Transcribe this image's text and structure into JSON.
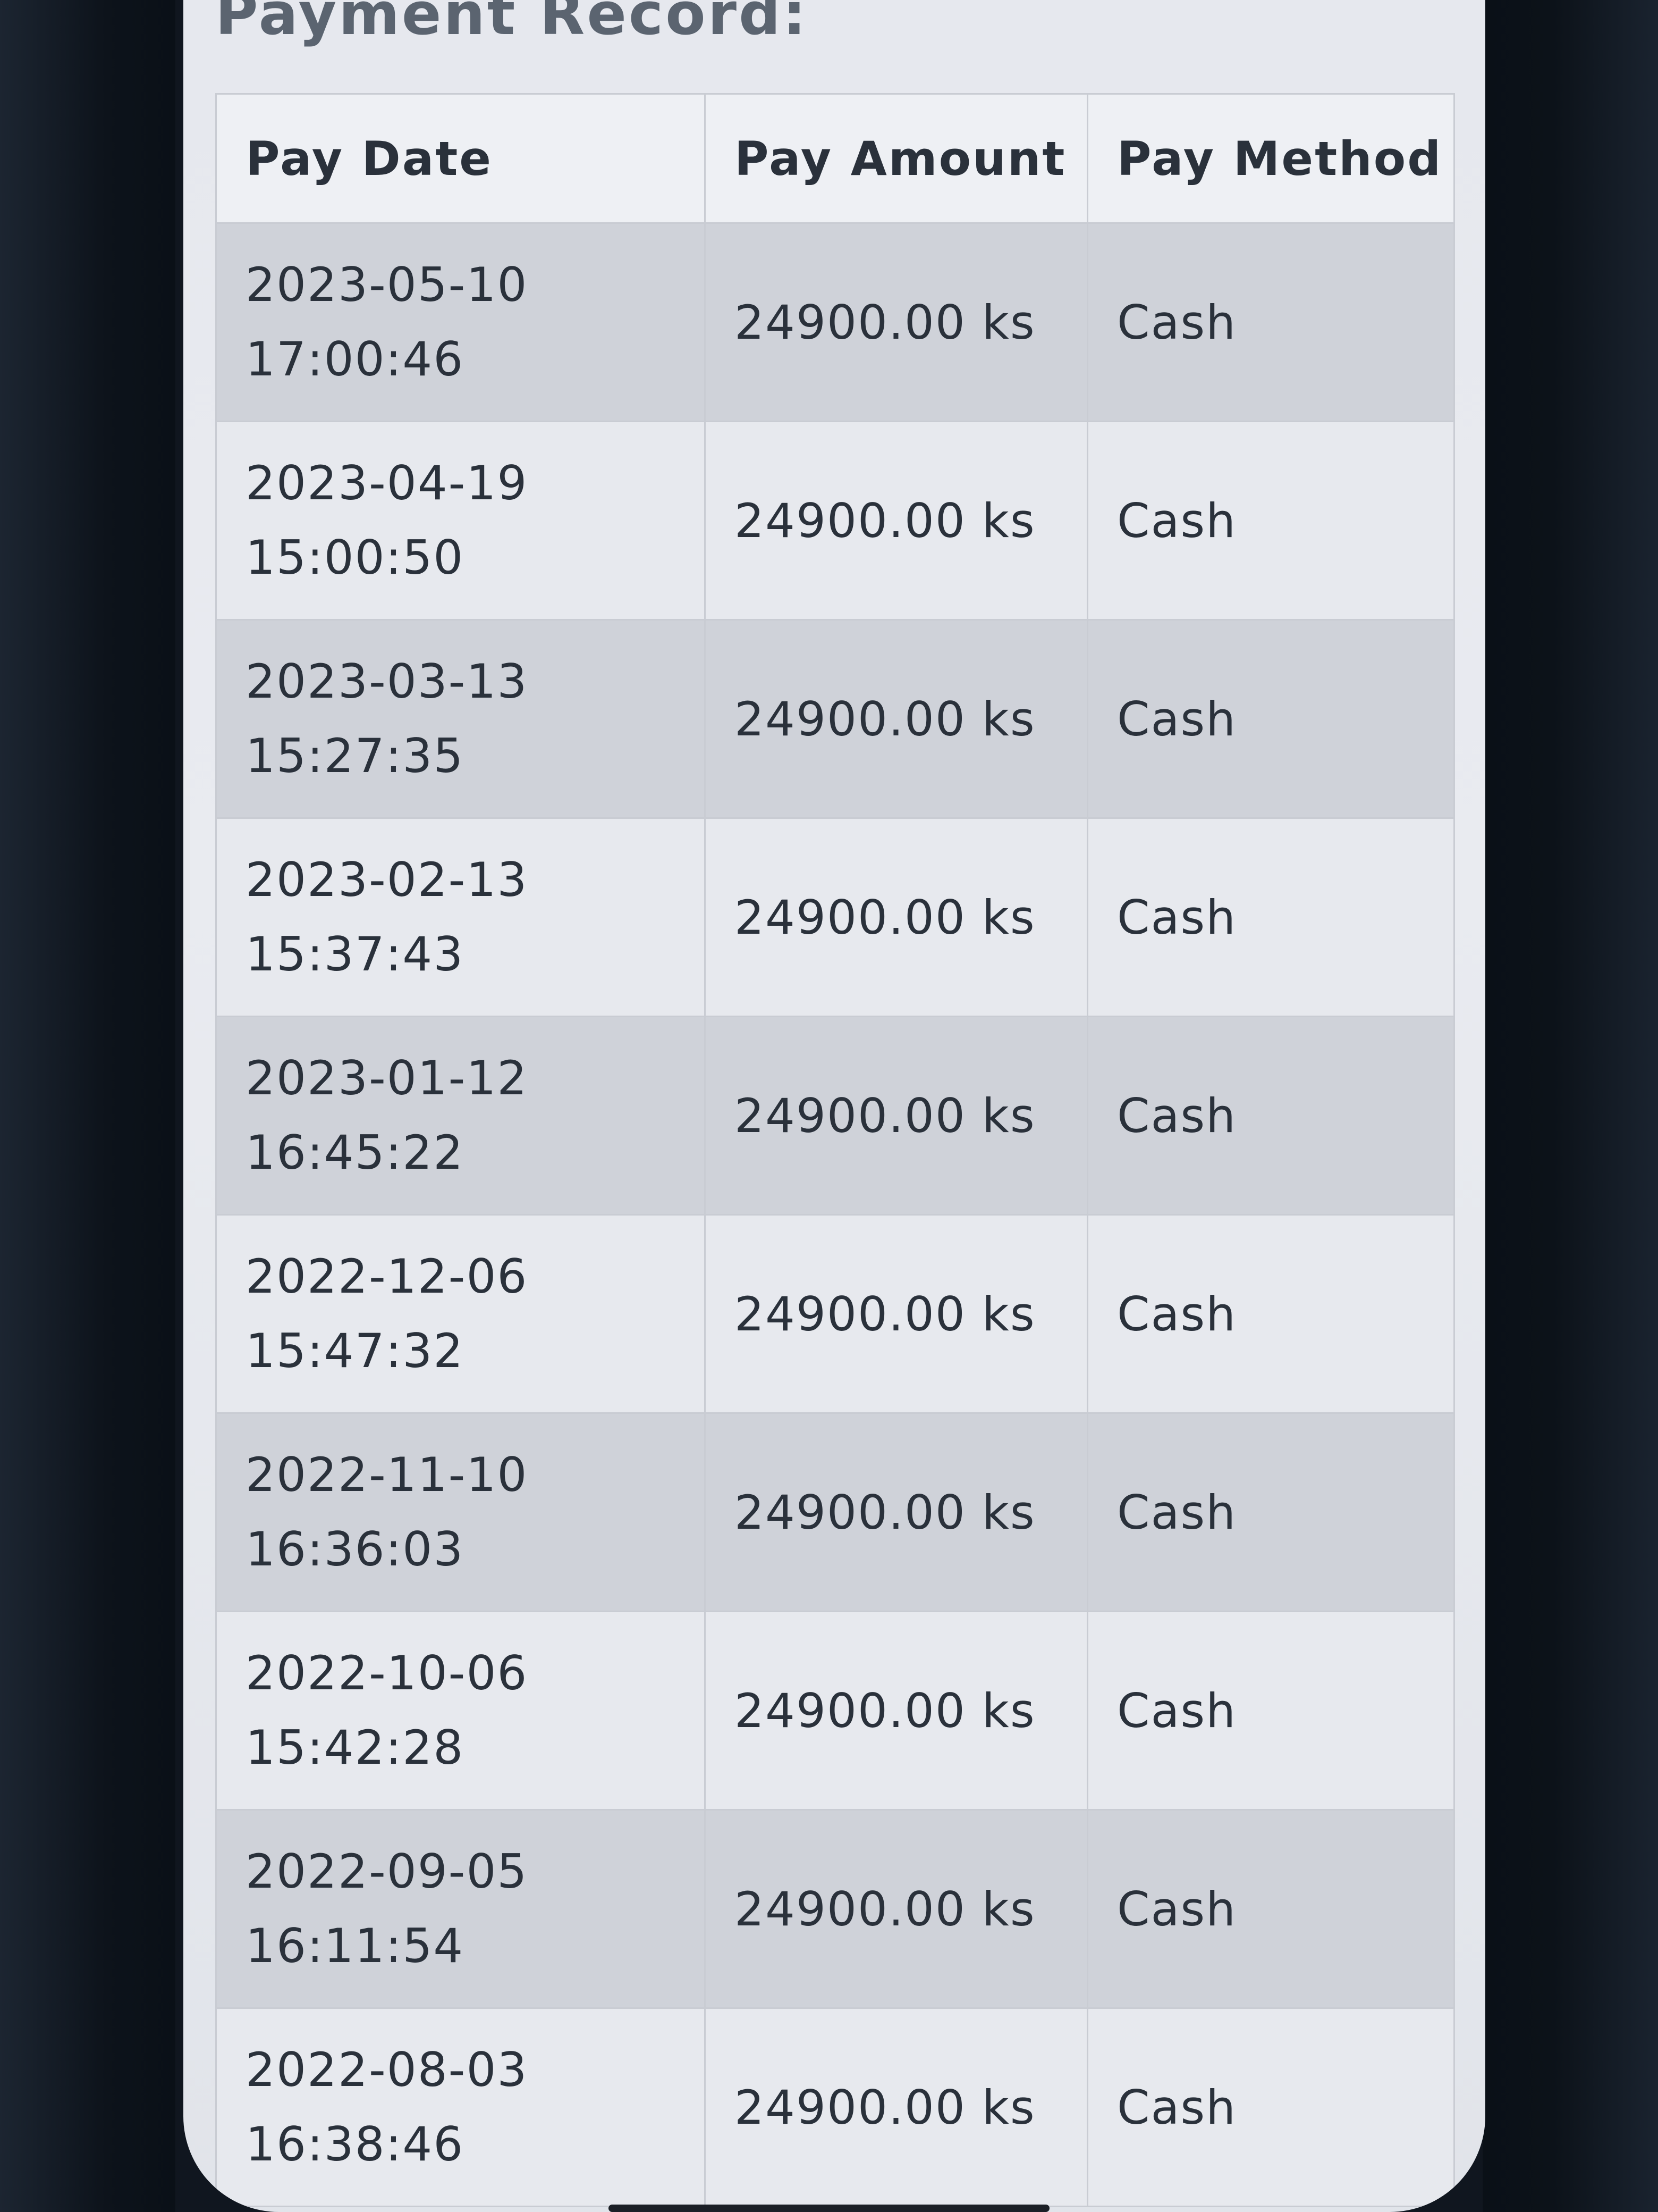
{
  "page": {
    "title": "Payment Record:"
  },
  "table": {
    "headers": {
      "pay_date": "Pay Date",
      "pay_amount": "Pay Amount",
      "pay_method": "Pay Method"
    },
    "rows": [
      {
        "date": "2023-05-10",
        "time": "17:00:46",
        "amount": "24900.00 ks",
        "method": "Cash"
      },
      {
        "date": "2023-04-19",
        "time": "15:00:50",
        "amount": "24900.00 ks",
        "method": "Cash"
      },
      {
        "date": "2023-03-13",
        "time": "15:27:35",
        "amount": "24900.00 ks",
        "method": "Cash"
      },
      {
        "date": "2023-02-13",
        "time": "15:37:43",
        "amount": "24900.00 ks",
        "method": "Cash"
      },
      {
        "date": "2023-01-12",
        "time": "16:45:22",
        "amount": "24900.00 ks",
        "method": "Cash"
      },
      {
        "date": "2022-12-06",
        "time": "15:47:32",
        "amount": "24900.00 ks",
        "method": "Cash"
      },
      {
        "date": "2022-11-10",
        "time": "16:36:03",
        "amount": "24900.00 ks",
        "method": "Cash"
      },
      {
        "date": "2022-10-06",
        "time": "15:42:28",
        "amount": "24900.00 ks",
        "method": "Cash"
      },
      {
        "date": "2022-09-05",
        "time": "16:11:54",
        "amount": "24900.00 ks",
        "method": "Cash"
      },
      {
        "date": "2022-08-03",
        "time": "16:38:46",
        "amount": "24900.00 ks",
        "method": "Cash"
      }
    ]
  },
  "colors": {
    "row_odd": "#cfd2d9",
    "row_even": "#e7e9ee",
    "text": "#2a313b",
    "title": "#5b6470"
  }
}
